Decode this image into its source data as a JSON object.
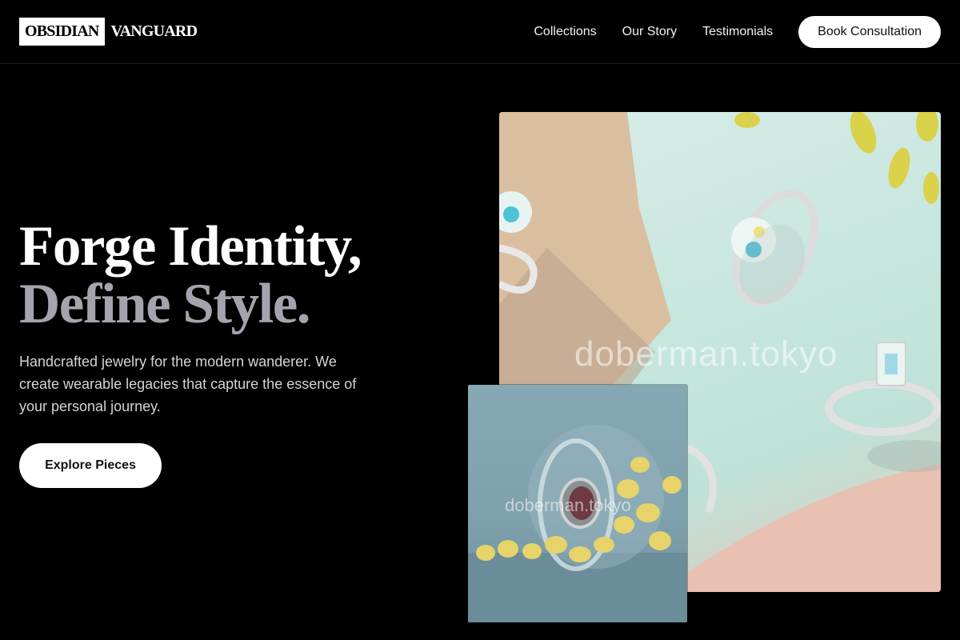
{
  "brand": {
    "name_boxed": "OBSIDIAN",
    "name_plain": "VANGUARD"
  },
  "nav": {
    "links": [
      "Collections",
      "Our Story",
      "Testimonials"
    ],
    "cta_label": "Book Consultation"
  },
  "hero": {
    "headline_line1": "Forge Identity,",
    "headline_line2": "Define Style.",
    "description": "Handcrafted jewelry for the modern wanderer. We create wearable legacies that capture the essence of your personal journey.",
    "button_label": "Explore Pieces"
  },
  "images": {
    "main_watermark": "doberman.tokyo",
    "secondary_watermark": "doberman.tokyo"
  },
  "colors": {
    "background": "#000000",
    "headline_secondary": "#a4a4ae",
    "button_bg": "#ffffff"
  }
}
